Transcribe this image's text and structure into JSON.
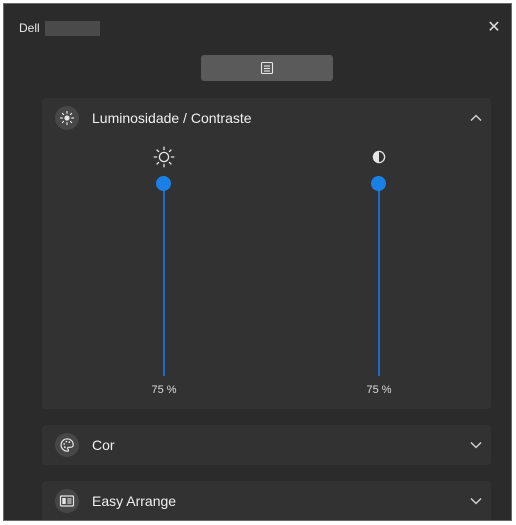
{
  "window": {
    "brand": "Dell",
    "close_glyph": "✕"
  },
  "colors": {
    "background": "#2b2b2b",
    "panel": "#323232",
    "accent": "#1a80e5"
  },
  "toolbar": {
    "menu_icon": "menu-icon"
  },
  "sections": [
    {
      "label": "Luminosidade / Contraste",
      "icon": "brightness-icon",
      "expanded": true,
      "sliders": [
        {
          "icon": "sun-icon",
          "value": 75,
          "value_text": "75 %"
        },
        {
          "icon": "contrast-icon",
          "value": 75,
          "value_text": "75 %"
        }
      ]
    },
    {
      "label": "Cor",
      "icon": "color-palette-icon",
      "expanded": false
    },
    {
      "label": "Easy Arrange",
      "icon": "easy-arrange-icon",
      "expanded": false
    }
  ]
}
